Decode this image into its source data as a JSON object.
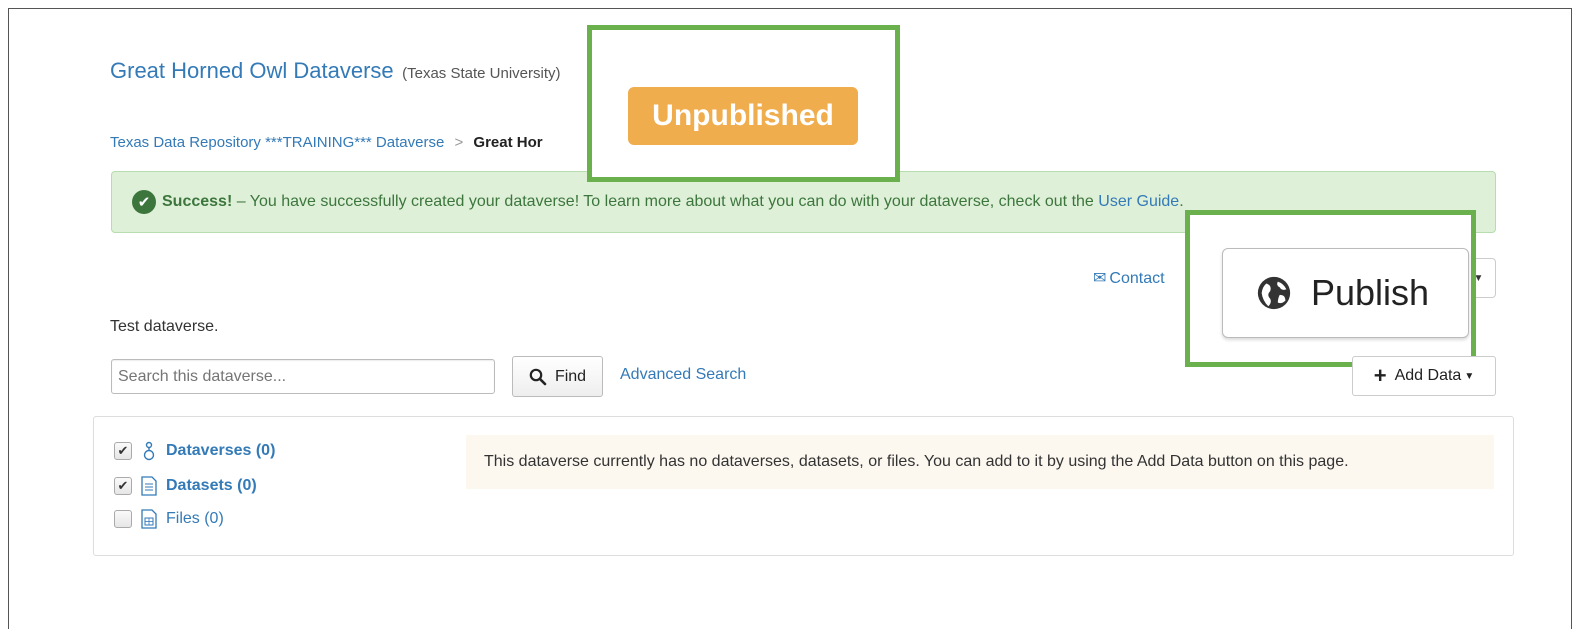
{
  "header": {
    "dataverse_name": "Great Horned Owl Dataverse",
    "affiliation": "(Texas State University)"
  },
  "breadcrumb": {
    "parent": "Texas Data Repository ***TRAINING*** Dataverse",
    "separator": ">",
    "current": "Great Hor"
  },
  "status_badge": "Unpublished",
  "alert": {
    "strong": "Success!",
    "message": " – You have successfully created your dataverse! To learn more about what you can do with your dataverse, check out the ",
    "link": "User Guide",
    "end": "."
  },
  "actions": {
    "contact": "Contact",
    "publish": "Publish",
    "add_data": "Add Data"
  },
  "description": "Test dataverse.",
  "search": {
    "placeholder": "Search this dataverse...",
    "find": "Find",
    "advanced": "Advanced Search"
  },
  "facets": [
    {
      "label": "Dataverses (0)",
      "checked": true
    },
    {
      "label": "Datasets (0)",
      "checked": true
    },
    {
      "label": "Files (0)",
      "checked": false
    }
  ],
  "empty_message": "This dataverse currently has no dataverses, datasets, or files. You can add to it by using the Add Data button on this page.",
  "colors": {
    "link": "#337ab7",
    "highlight": "#6ab04c",
    "badge": "#f0ad4e",
    "alert_bg": "#dff0d8"
  }
}
